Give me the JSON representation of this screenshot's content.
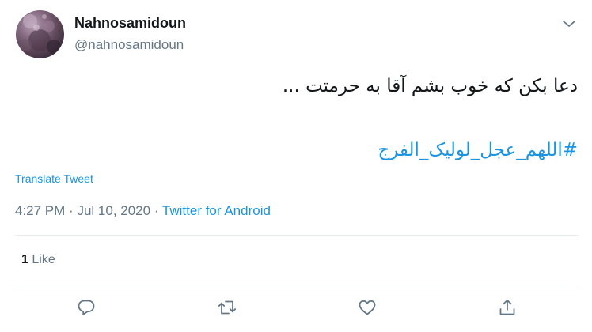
{
  "user": {
    "display_name": "Nahnosamidoun",
    "handle": "@nahnosamidoun",
    "avatar_icon": "profile-photo"
  },
  "tweet": {
    "text": "دعا بکن که خوب بشم آقا به حرمتت ...",
    "hashtag": "#اللهم_عجل_لولیک_الفرج",
    "translate_label": "Translate Tweet",
    "time": "4:27 PM",
    "separator": "·",
    "date": "Jul 10, 2020",
    "source": "Twitter for Android"
  },
  "stats": {
    "likes_count": "1",
    "likes_label": "Like"
  },
  "actions": {
    "reply_icon": "reply-icon",
    "retweet_icon": "retweet-icon",
    "like_icon": "heart-icon",
    "share_icon": "share-icon"
  },
  "colors": {
    "link": "#1b95e0",
    "secondary_text": "#657786",
    "primary_text": "#14171a",
    "divider": "#e6ecf0"
  }
}
